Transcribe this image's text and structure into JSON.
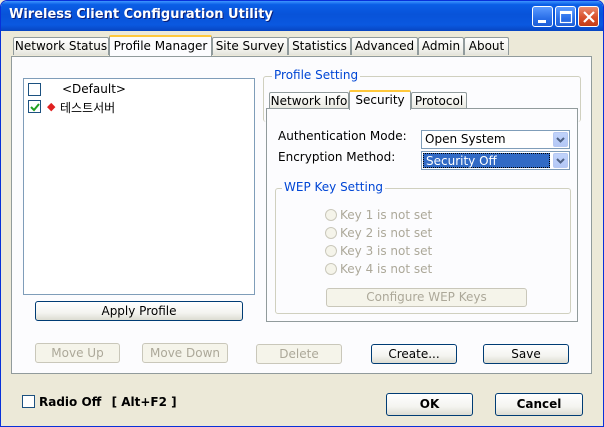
{
  "window": {
    "title": "Wireless Client Configuration Utility"
  },
  "tabs": [
    "Network Status",
    "Profile Manager",
    "Site Survey",
    "Statistics",
    "Advanced",
    "Admin",
    "About"
  ],
  "profiles": [
    {
      "name": "<Default>",
      "checked": false
    },
    {
      "name": "테스트서버",
      "checked": true
    }
  ],
  "buttons": {
    "apply_profile": "Apply Profile",
    "move_up": "Move Up",
    "move_down": "Move Down",
    "delete": "Delete",
    "create": "Create...",
    "save": "Save",
    "ok": "OK",
    "cancel": "Cancel"
  },
  "profile_setting": {
    "title": "Profile Setting",
    "subtabs": [
      "Network Info",
      "Security",
      "Protocol"
    ],
    "auth_label": "Authentication Mode:",
    "auth_value": "Open System",
    "enc_label": "Encryption Method:",
    "enc_value": "Security Off",
    "wep_title": "WEP Key Setting",
    "wep_keys": [
      "Key 1 is not set",
      "Key 2 is not set",
      "Key 3 is not set",
      "Key 4 is not set"
    ],
    "configure_wep": "Configure WEP Keys"
  },
  "radio_off": {
    "label": "Radio Off",
    "shortcut": "[ Alt+F2 ]"
  }
}
